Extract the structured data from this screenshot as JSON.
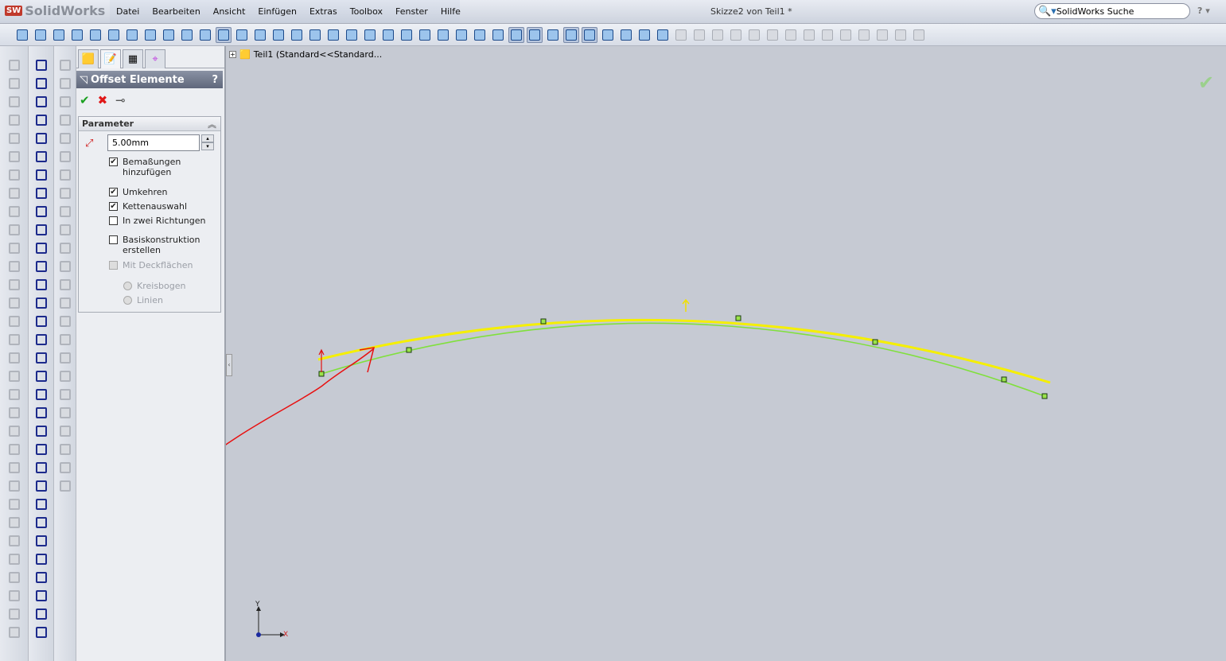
{
  "app": {
    "name": "SolidWorks",
    "document_title": "Skizze2 von Teil1 *",
    "search_placeholder": "SolidWorks Suche",
    "help": "?"
  },
  "menu": [
    "Datei",
    "Bearbeiten",
    "Ansicht",
    "Einfügen",
    "Extras",
    "Toolbox",
    "Fenster",
    "Hilfe"
  ],
  "toolbar": {
    "icons": [
      "new",
      "open",
      "save",
      "print",
      "preview",
      "options",
      "rebuild",
      "undo",
      "redo",
      "traffic-light",
      "select",
      "view-front",
      "view-back",
      "view-left",
      "view-right",
      "view-top",
      "view-bottom",
      "view-iso",
      "view-tri",
      "view-di",
      "shaded",
      "shaded-edges",
      "hidden",
      "wireframe",
      "section",
      "display",
      "appearance",
      "scene",
      "sketch",
      "smart-dim",
      "relations",
      "snap",
      "grid",
      "repair",
      "trim",
      "extend",
      "offset",
      "mirror",
      "move",
      "rotate",
      "scale",
      "copy",
      "stretch",
      "split",
      "point",
      "fillet",
      "chamfer",
      "text",
      "plane",
      "spline"
    ],
    "selected": [
      11,
      27,
      28,
      30,
      31
    ]
  },
  "panel": {
    "tabs": [
      "feature-manager",
      "property-manager",
      "configuration-manager",
      "dimxpert"
    ],
    "title": "Offset Elemente",
    "help": "?",
    "group_title": "Parameter",
    "offset_value": "5.00mm",
    "options": [
      {
        "label": "Bemaßungen",
        "label2": "hinzufügen",
        "checked": true
      },
      {
        "label": "Umkehren",
        "checked": true
      },
      {
        "label": "Kettenauswahl",
        "checked": true
      },
      {
        "label": "In zwei Richtungen",
        "checked": false
      },
      {
        "label": "Basiskonstruktion",
        "label2": "erstellen",
        "checked": false
      },
      {
        "label": "Mit Deckflächen",
        "checked": false,
        "disabled": true
      }
    ],
    "radios": [
      "Kreisbogen",
      "Linien"
    ]
  },
  "tree": {
    "root": "Teil1  (Standard<<Standard..."
  },
  "axes": {
    "x": "X",
    "y": "Y"
  },
  "colors": {
    "offset_curve": "#f5f000",
    "sketch_curve": "#7ee03a",
    "annotation": "#e01010",
    "highlight": "#e8f000"
  }
}
